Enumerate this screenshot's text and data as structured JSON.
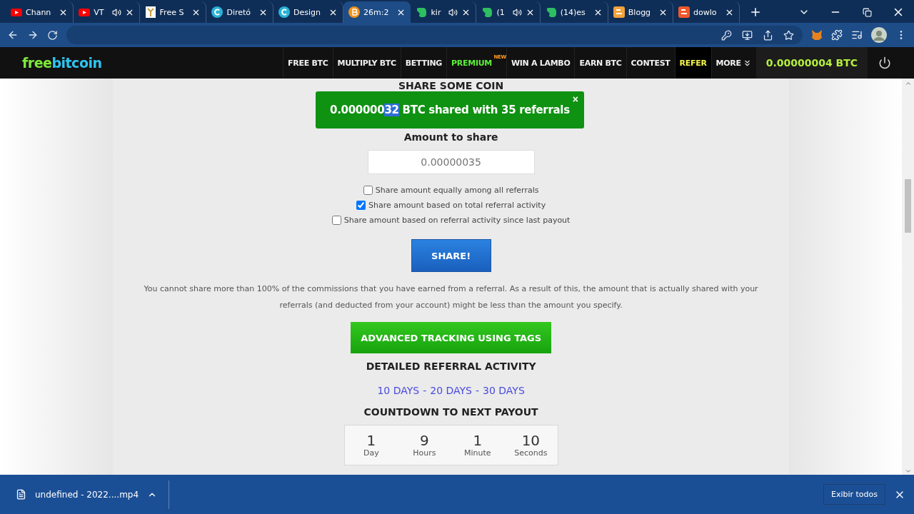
{
  "browser": {
    "tabs": [
      {
        "title": "Chann",
        "kind": "youtube",
        "audio": false,
        "selected": false
      },
      {
        "title": "VT",
        "kind": "youtube",
        "audio": true,
        "selected": false
      },
      {
        "title": "Free S",
        "kind": "sheet",
        "audio": false,
        "selected": false
      },
      {
        "title": "Diretó",
        "kind": "canva",
        "audio": false,
        "selected": false
      },
      {
        "title": "Design",
        "kind": "canva",
        "audio": false,
        "selected": false
      },
      {
        "title": "26m:2",
        "kind": "bitcoin",
        "audio": false,
        "selected": true
      },
      {
        "title": "kir",
        "kind": "evernote",
        "audio": true,
        "selected": false
      },
      {
        "title": "(1",
        "kind": "evernote",
        "audio": true,
        "selected": false
      },
      {
        "title": "(14)es",
        "kind": "evernote",
        "audio": false,
        "selected": false
      },
      {
        "title": "Blogg",
        "kind": "blogger",
        "audio": false,
        "selected": false
      },
      {
        "title": "dowlo",
        "kind": "blogger-red",
        "audio": false,
        "selected": false
      }
    ]
  },
  "site": {
    "logo": {
      "first": "free",
      "second": "bitcoin"
    },
    "nav": [
      {
        "label": "FREE BTC",
        "kind": "plain",
        "selected": false
      },
      {
        "label": "MULTIPLY BTC",
        "kind": "plain",
        "selected": false
      },
      {
        "label": "BETTING",
        "kind": "plain",
        "selected": false
      },
      {
        "label": "PREMIUM",
        "kind": "green",
        "badge": "NEW",
        "selected": false
      },
      {
        "label": "WIN A LAMBO",
        "kind": "plain",
        "selected": false
      },
      {
        "label": "EARN BTC",
        "kind": "plain",
        "selected": false
      },
      {
        "label": "CONTEST",
        "kind": "plain",
        "selected": false
      },
      {
        "label": "REFER",
        "kind": "yellow",
        "selected": true
      },
      {
        "label": "MORE",
        "kind": "more",
        "selected": false
      }
    ],
    "balance": "0.00000004 BTC"
  },
  "share": {
    "heading": "SHARE SOME COIN",
    "toast": {
      "parts": [
        {
          "text": "0.000000",
          "highlighted": false
        },
        {
          "text": "32",
          "highlighted": true
        },
        {
          "text": " BTC shared with 35 referrals",
          "highlighted": false
        }
      ],
      "close": "×"
    },
    "amount_label": "Amount to share",
    "amount": {
      "placeholder": "0.00000035"
    },
    "options": [
      {
        "label": "Share amount equally among all referrals",
        "checked": false
      },
      {
        "label": "Share amount based on total referral activity",
        "checked": true
      },
      {
        "label": "Share amount based on referral activity since last payout",
        "checked": false
      }
    ],
    "button": "SHARE!",
    "note": "You cannot share more than 100% of the commissions that you have earned from a referral. As a result of this, the amount that is actually shared with your referrals (and deducted from your account) might be less than the amount you specify.",
    "tracking_button": "ADVANCED TRACKING USING TAGS",
    "activity_heading": "DETAILED REFERRAL ACTIVITY",
    "ranges": [
      "10 DAYS",
      "20 DAYS",
      "30 DAYS"
    ],
    "range_separator": "-",
    "countdown_heading": "COUNTDOWN TO NEXT PAYOUT",
    "countdown": [
      {
        "value": "1",
        "unit": "Day"
      },
      {
        "value": "9",
        "unit": "Hours"
      },
      {
        "value": "1",
        "unit": "Minute"
      },
      {
        "value": "10",
        "unit": "Seconds"
      }
    ]
  },
  "downloads": {
    "file": "undefined - 2022....mp4",
    "show_all": "Exibir todos"
  }
}
